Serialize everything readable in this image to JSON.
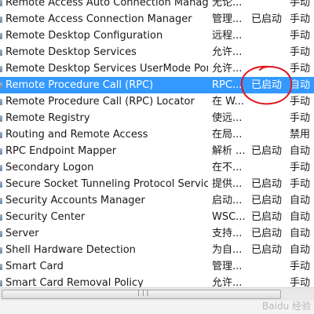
{
  "services": [
    {
      "name": "Remote Access Auto Connection Manager",
      "description": "无论...",
      "status": "",
      "startup": "手动"
    },
    {
      "name": "Remote Access Connection Manager",
      "description": "管理...",
      "status": "已启动",
      "startup": "手动"
    },
    {
      "name": "Remote Desktop Configuration",
      "description": "远程...",
      "status": "",
      "startup": "手动"
    },
    {
      "name": "Remote Desktop Services",
      "description": "允许...",
      "status": "",
      "startup": "手动"
    },
    {
      "name": "Remote Desktop Services UserMode Port ...",
      "description": "允许...",
      "status": "",
      "startup": "手动"
    },
    {
      "name": "Remote Procedure Call (RPC)",
      "description": "RPC...",
      "status": "已启动",
      "startup": "自动",
      "selected": true
    },
    {
      "name": "Remote Procedure Call (RPC) Locator",
      "description": "在 W...",
      "status": "",
      "startup": "手动"
    },
    {
      "name": "Remote Registry",
      "description": "使远...",
      "status": "",
      "startup": "手动"
    },
    {
      "name": "Routing and Remote Access",
      "description": "在局...",
      "status": "",
      "startup": "禁用"
    },
    {
      "name": "RPC Endpoint Mapper",
      "description": "解析 ...",
      "status": "已启动",
      "startup": "自动"
    },
    {
      "name": "Secondary Logon",
      "description": "在不...",
      "status": "",
      "startup": "手动"
    },
    {
      "name": "Secure Socket Tunneling Protocol Service",
      "description": "提供...",
      "status": "已启动",
      "startup": "手动"
    },
    {
      "name": "Security Accounts Manager",
      "description": "启动...",
      "status": "已启动",
      "startup": "自动"
    },
    {
      "name": "Security Center",
      "description": "WSC...",
      "status": "已启动",
      "startup": "自动"
    },
    {
      "name": "Server",
      "description": "支持...",
      "status": "已启动",
      "startup": "自动"
    },
    {
      "name": "Shell Hardware Detection",
      "description": "为自...",
      "status": "已启动",
      "startup": "自动"
    },
    {
      "name": "Smart Card",
      "description": "管理...",
      "status": "",
      "startup": "手动"
    },
    {
      "name": "Smart Card Removal Policy",
      "description": "允许...",
      "status": "",
      "startup": "手动"
    }
  ],
  "scrollbar": {
    "grip": "|||"
  },
  "watermark": "Baidu 经验",
  "colors": {
    "selection": "#3399ff",
    "annotation": "#e0141e"
  },
  "icons": {
    "row_icon": "service-gear-icon",
    "annotation": "red-circle-annotation"
  }
}
